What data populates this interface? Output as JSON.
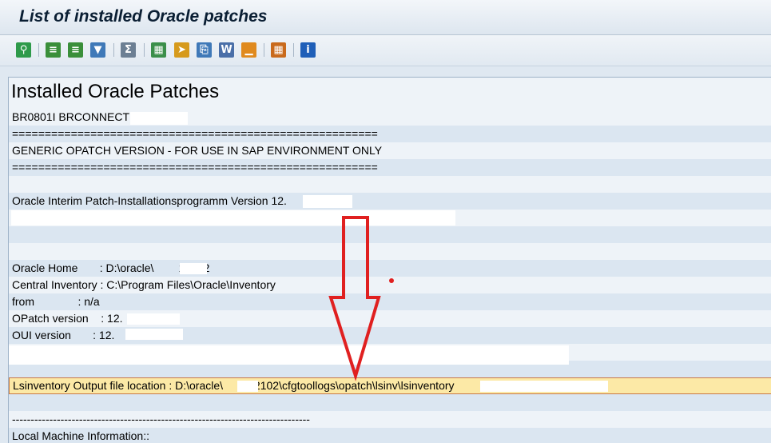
{
  "window": {
    "title": "List of installed Oracle patches"
  },
  "toolbar": {
    "icons": [
      "details-icon",
      "sort-ascending-icon",
      "sort-descending-icon",
      "filter-icon",
      "total-icon",
      "export-icon",
      "send-icon",
      "print-preview-icon",
      "word-processing-icon",
      "chart-icon",
      "layout-icon",
      "info-icon"
    ],
    "tooltips": [
      "Details",
      "Sort in Ascending Order",
      "Sort in Descending Order",
      "Set Filter",
      "Total",
      "Spreadsheet",
      "Send",
      "Print Preview",
      "Word Processing",
      "Graphic",
      "Change Layout",
      "Information"
    ]
  },
  "report": {
    "heading": "Installed Oracle Patches",
    "lines": [
      "BR0801I BRCONNECT",
      "========================================================",
      "GENERIC OPATCH VERSION - FOR USE IN SAP ENVIRONMENT ONLY",
      "========================================================",
      "",
      "Oracle Interim Patch-Installationsprogramm Version 12.",
      "",
      "",
      "",
      "Oracle Home       : D:\\oracle\\        12102",
      "Central Inventory : C:\\Program Files\\Oracle\\Inventory",
      "from              : n/a",
      "OPatch version    : 12.",
      "OUI version       : 12.",
      "",
      "",
      "Lsinventory Output file location : D:\\oracle\\       \\12102\\cfgtoollogs\\opatch\\lsinv\\lsinventory                                        .txt",
      "",
      "--------------------------------------------------------------------------------",
      "Local Machine Information::"
    ]
  },
  "colors": {
    "accent": "#e02020",
    "selection": "#fce9a6",
    "row_alt": "#dbe6f1"
  }
}
